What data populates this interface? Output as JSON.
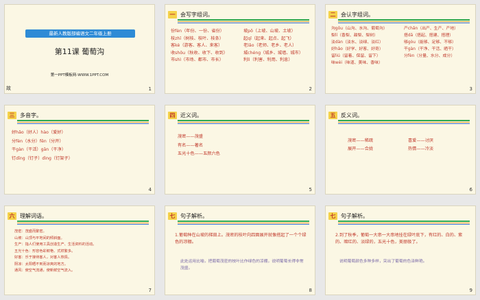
{
  "slides": {
    "s1": {
      "banner": "最新人教版部编语文二年级上册",
      "title": "第11课 葡萄沟",
      "site": "第一PPT模板网-WWW.1PPT.COM",
      "num": "1",
      "left_char": "故"
    },
    "s2": {
      "badge": "一",
      "title": "会写字组词。",
      "num": "2",
      "col1": [
        "份fèn（年份、一份、省份）",
        "枝zhī（树枝、枝叶、枝条）",
        "客kè（游客、客人、来客）",
        "收shōu（秋收、收下、收到）",
        "市shì（市场、都市、市长）"
      ],
      "col2": [
        "坡pō（上坡、山坡、土坡）",
        "起qǐ（起来、起点、起飞）",
        "老lǎo（老师、老乡、老人）",
        "城chéng（城乡、城墙、城市）",
        "利lì（利害、利用、利息）"
      ]
    },
    "s3": {
      "badge": "二",
      "title": "会认字组词。",
      "num": "3",
      "col1": [
        "沟gōu（山沟、水沟、葡萄沟）",
        "梨lí（香梨、甜梨、梨树）",
        "淡dàn（淡水、淡绿、淡红）",
        "好hǎo（好学、好客、好奇）",
        "留liú（留着、保留、留下）",
        "味wèi（味道、美味、香味）"
      ],
      "col2": [
        "产chǎn（出产、生产、产地）",
        "搭dā（搭起、搭建、搭理）",
        "够gòu（能够、足够、不够）",
        "干gàn（干净、干活、晒干）",
        "分fèn（分量、水分、成分）"
      ]
    },
    "s4": {
      "badge": "三",
      "title": "多音字。",
      "num": "4",
      "lines": [
        "好hǎo（好人）hào（爱好）",
        "分fèn（水分）fēn（分开）",
        "干gàn（干活）gān（干净）",
        "钉dīng（钉子）dìng（钉架子）"
      ]
    },
    "s5": {
      "badge": "四",
      "title": "近义词。",
      "num": "5",
      "lines": [
        "茂密——茂盛",
        "有名——著名",
        "五光十色——五颜六色"
      ]
    },
    "s6": {
      "badge": "五",
      "title": "反义词。",
      "num": "6",
      "col1": [
        "茂密——稀疏",
        "展开——合拢"
      ],
      "col2": [
        "喜爱——讨厌",
        "热情——冷淡"
      ]
    },
    "s7": {
      "badge": "六",
      "title": "理解词语。",
      "num": "7",
      "lines": [
        "茂密：茂盛而繁密。",
        "山坡：山顶与平地间的倾斜面。",
        "生产：指人们使用工具创造生产、生活资料的活动。",
        "五光十色：形容色彩鲜艳、式样繁多。",
        "好客：乐于接待客人，对客人热情。",
        "阴凉：太阳晒不到而凉爽的地方。",
        "通风：使空气流通，使新鲜空气流入。"
      ]
    },
    "s8": {
      "badge": "七",
      "title": "句子解析。",
      "num": "8",
      "sentence": "1.葡萄种在山坡的梯田上。茂密的枝叶向四面展开就像搭起了一个个绿色的凉棚。",
      "note": "此处运用比喻，把葡萄茂密的枝叶比作绿色的凉棚，说明葡萄长得非常茂盛。"
    },
    "s9": {
      "badge": "七",
      "title": "句子解析。",
      "num": "9",
      "sentence": "2.到了秋季，葡萄一大串一大串地挂在绿叶底下，有红的、白的、紫的、暗红的、淡绿的，五光十色，美丽极了。",
      "note": "说明葡萄颜色多种多样，突出了葡萄的色泽鲜艳。"
    }
  }
}
